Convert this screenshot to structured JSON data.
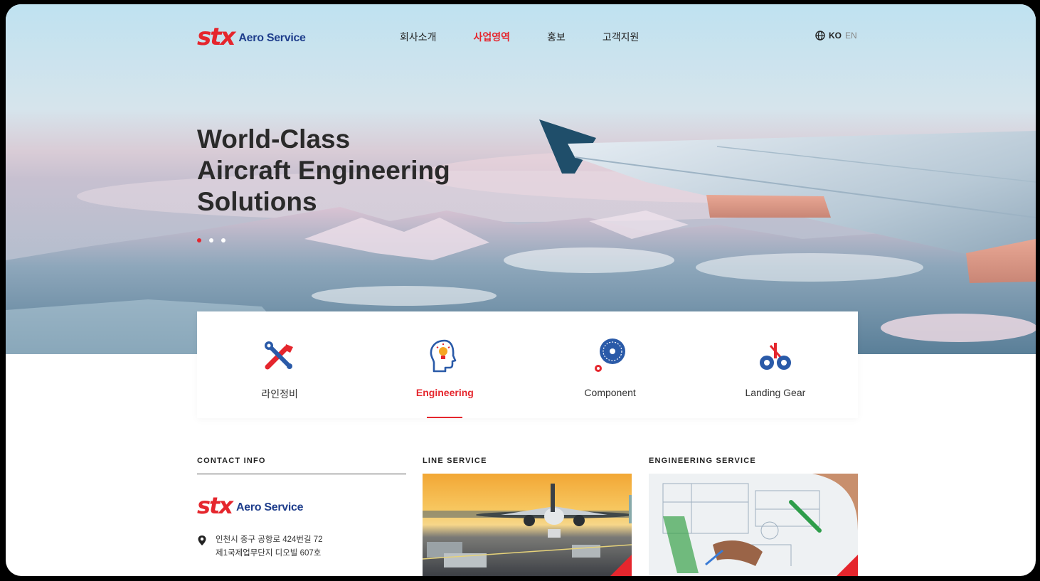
{
  "brand": {
    "mark": "stx",
    "name": "Aero Service",
    "color": "#e5262d",
    "name_color": "#1f3e8c"
  },
  "nav": {
    "items": [
      {
        "label": "회사소개",
        "active": false
      },
      {
        "label": "사업영역",
        "active": true
      },
      {
        "label": "홍보",
        "active": false
      },
      {
        "label": "고객지원",
        "active": false
      }
    ]
  },
  "language": {
    "icon": "globe-icon",
    "current": "KO",
    "alternate": "EN"
  },
  "hero": {
    "title_lines": [
      "World-Class",
      "Aircraft Engineering",
      "Solutions"
    ],
    "slides": {
      "count": 3,
      "active_index": 0
    }
  },
  "services": {
    "items": [
      {
        "label": "라인정비",
        "icon": "tools-icon"
      },
      {
        "label": "Engineering",
        "icon": "head-lightbulb-icon",
        "active": true
      },
      {
        "label": "Component",
        "icon": "turbine-gear-icon"
      },
      {
        "label": "Landing Gear",
        "icon": "landing-gear-icon"
      }
    ]
  },
  "bottom": {
    "contact": {
      "title": "CONTACT INFO",
      "address_line1": "인천시 중구 공항로 424번길 72",
      "address_line2": "제1국제업무단지 디오빌 607호"
    },
    "line_service": {
      "title": "LINE SERVICE"
    },
    "engineering_service": {
      "title": "ENGINEERING SERVICE"
    }
  },
  "colors": {
    "accent": "#e5262d",
    "icon_blue": "#2a5aa8"
  }
}
